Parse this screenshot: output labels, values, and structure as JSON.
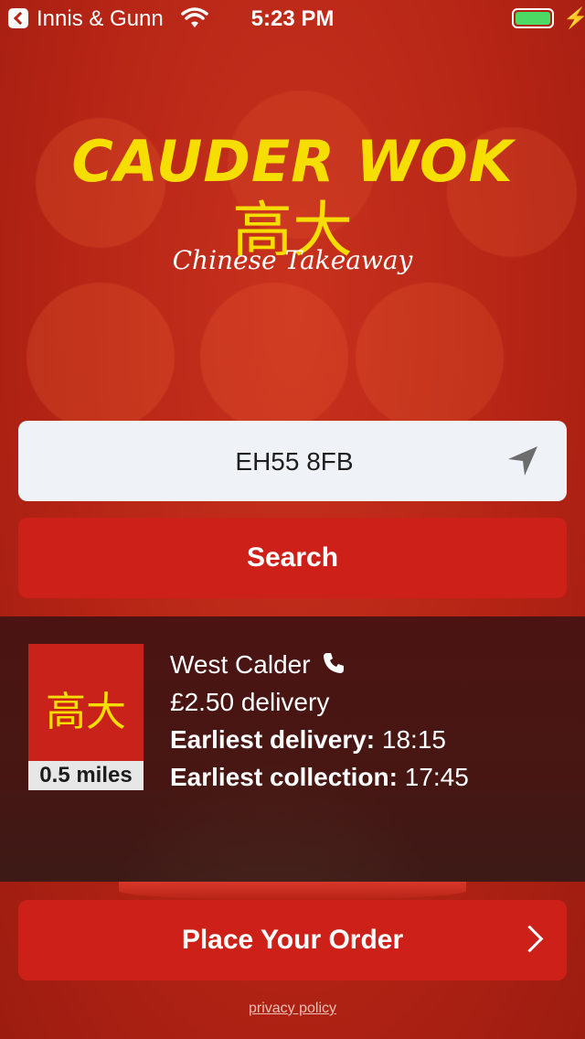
{
  "status_bar": {
    "back_app": "Innis & Gunn",
    "time": "5:23 PM",
    "battery_level": 1.0,
    "icons": [
      "back-chevron-icon",
      "wifi-icon",
      "battery-icon",
      "charging-bolt-icon"
    ]
  },
  "logo": {
    "title": "CAUDER WOK",
    "chinese": "高大",
    "subtitle": "Chinese Takeaway"
  },
  "search": {
    "postcode_value": "EH55 8FB",
    "locate_icon": "location-arrow-icon",
    "button_label": "Search"
  },
  "store": {
    "image_text": "高大",
    "distance": "0.5 miles",
    "name": "West Calder",
    "phone_icon": "phone-icon",
    "delivery_fee": "£2.50 delivery",
    "earliest_delivery_label": "Earliest delivery:",
    "earliest_delivery_time": "18:15",
    "earliest_collection_label": "Earliest collection:",
    "earliest_collection_time": "17:45"
  },
  "footer": {
    "order_button_label": "Place Your Order",
    "order_icon": "chevron-right-icon",
    "privacy_link": "privacy policy"
  },
  "colors": {
    "background_red": "#b52415",
    "button_red": "#cc2019",
    "logo_yellow": "#f5de00",
    "input_bg": "#eff2f6",
    "battery_green": "#4cd964"
  }
}
